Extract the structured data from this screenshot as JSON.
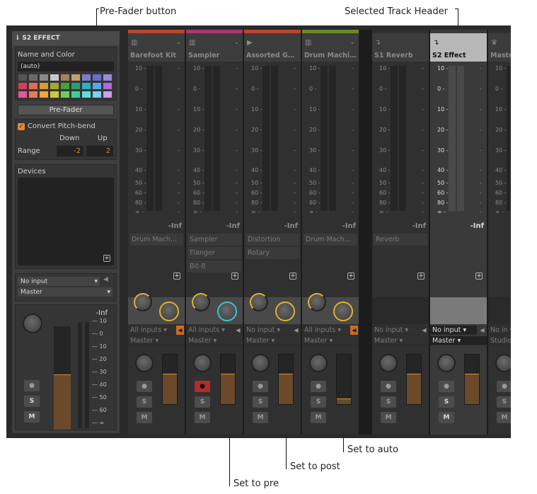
{
  "callouts": {
    "pre_fader": "Pre-Fader button",
    "selected_header": "Selected Track Header",
    "set_to_auto": "Set to auto",
    "set_to_post": "Set to post",
    "set_to_pre": "Set to pre"
  },
  "inspector": {
    "title": "S2 EFFECT",
    "name_label": "Name and Color",
    "name_value": "(auto)",
    "prefader_label": "Pre-Fader",
    "convert_label": "Convert Pitch-bend",
    "down_label": "Down",
    "up_label": "Up",
    "range_label": "Range",
    "range_down": "-2",
    "range_up": "2",
    "devices_label": "Devices",
    "input_value": "No input",
    "output_value": "Master",
    "meter_inf": "-Inf",
    "meter_scale": [
      "10",
      "0",
      "10",
      "20",
      "30",
      "40",
      "50",
      "60",
      "∞"
    ],
    "solo_label": "S",
    "mute_label": "M"
  },
  "palette": [
    "#555555",
    "#6a6a6a",
    "#8a8a8a",
    "#c9c9c9",
    "#a1845a",
    "#c2a06e",
    "#7b7bcf",
    "#6c6cc9",
    "#9a8ad8",
    "#d23f5a",
    "#e86a4a",
    "#d99a2a",
    "#a6a62a",
    "#3aa63a",
    "#2a9a7a",
    "#2ab0c9",
    "#5aa6e6",
    "#b06ad6",
    "#e05a9a",
    "#e87a5a",
    "#f0a83a",
    "#c9c93a",
    "#6acf5a",
    "#3acf9a",
    "#5adfe0",
    "#7ad0f0",
    "#c9a0e8"
  ],
  "meter_ticks": [
    "10",
    "0",
    "10",
    "20",
    "30",
    "40",
    "50",
    "60",
    "80",
    "∞"
  ],
  "tracks": [
    {
      "name": "Barefoot Kit",
      "icon": "piano-icon",
      "glyph": "▥",
      "color": "#b8472e",
      "inf": "-Inf",
      "devices": [
        "Drum Mach..."
      ],
      "input": "All inputs",
      "output": "Master",
      "fader_level": 0.62,
      "solo": "S",
      "mute": "M",
      "rec_active": false,
      "knob_ring": "#e0b030",
      "send_mode": "pre"
    },
    {
      "name": "Sampler",
      "icon": "piano-icon",
      "glyph": "▥",
      "color": "#a83a6a",
      "inf": "-Inf",
      "devices": [
        "Sampler",
        "Flanger",
        "Bit-8"
      ],
      "input": "All inputs",
      "output": "Master",
      "fader_level": 0.62,
      "solo": "S",
      "mute": "M",
      "rec_active": true,
      "knob_ring": "#40c0d0",
      "send_mode": "pre"
    },
    {
      "name": "Assorted Go...",
      "icon": "play-icon",
      "glyph": "▶",
      "color": "#b8472e",
      "inf": "-Inf",
      "devices": [
        "Distortion",
        "Rotary"
      ],
      "input": "No input",
      "output": "Master",
      "fader_level": 0.62,
      "solo": "S",
      "mute": "M",
      "rec_active": false,
      "knob_ring": "#e0b030",
      "send_mode": "post"
    },
    {
      "name": "Drum Machi...",
      "icon": "piano-icon",
      "glyph": "▥",
      "color": "#6a8a2a",
      "inf": "-Inf",
      "devices": [
        "Drum Mach..."
      ],
      "input": "All inputs",
      "output": "Master",
      "fader_level": 0.12,
      "solo": "S",
      "mute": "M",
      "rec_active": false,
      "knob_ring": "#e0b030",
      "send_mode": "auto"
    },
    {
      "name": "S1 Reverb",
      "icon": "return-icon",
      "glyph": "↴",
      "color": "#303030",
      "inf": "-Inf",
      "devices": [
        "Reverb"
      ],
      "input": "No input",
      "output": "Master",
      "fader_level": 0.62,
      "solo": "S",
      "mute": "M",
      "rec_active": false,
      "knob_ring": "",
      "send_mode": ""
    },
    {
      "name": "S2 Effect",
      "icon": "return-icon",
      "glyph": "↴",
      "color": "#3a3a3a",
      "inf": "-Inf",
      "devices": [],
      "input": "No input",
      "output": "Master",
      "fader_level": 0.62,
      "solo": "S",
      "mute": "M",
      "rec_active": false,
      "knob_ring": "",
      "send_mode": "",
      "selected": true
    },
    {
      "name": "Master",
      "icon": "crown-icon",
      "glyph": "♛",
      "color": "#303030",
      "inf": "",
      "devices": [],
      "input": "No in",
      "output": "Studio",
      "fader_level": 0.62,
      "solo": "S",
      "mute": "M",
      "rec_active": false,
      "knob_ring": "",
      "send_mode": ""
    }
  ]
}
